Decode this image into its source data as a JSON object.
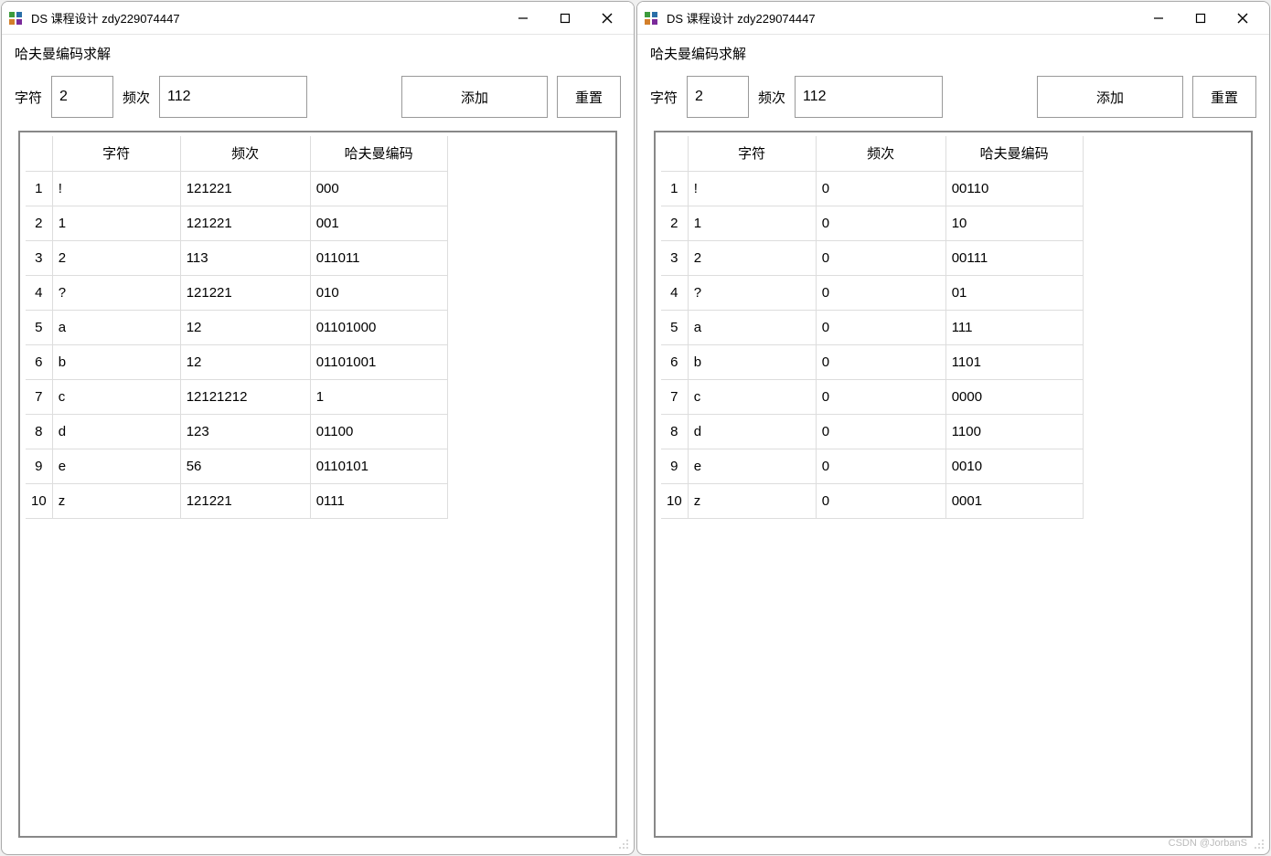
{
  "watermark": "CSDN @JorbanS",
  "windows": [
    {
      "title": "DS 课程设计 zdy229074447",
      "subtitle": "哈夫曼编码求解",
      "form": {
        "char_label": "字符",
        "char_value": "2",
        "freq_label": "频次",
        "freq_value": "112",
        "add_label": "添加",
        "reset_label": "重置"
      },
      "table": {
        "headers": {
          "char": "字符",
          "freq": "频次",
          "code": "哈夫曼编码"
        },
        "rows": [
          {
            "idx": "1",
            "char": "!",
            "freq": "121221",
            "code": "000"
          },
          {
            "idx": "2",
            "char": "1",
            "freq": "121221",
            "code": "001"
          },
          {
            "idx": "3",
            "char": "2",
            "freq": "113",
            "code": "011011"
          },
          {
            "idx": "4",
            "char": "?",
            "freq": "121221",
            "code": "010"
          },
          {
            "idx": "5",
            "char": "a",
            "freq": "12",
            "code": "01101000"
          },
          {
            "idx": "6",
            "char": "b",
            "freq": "12",
            "code": "01101001"
          },
          {
            "idx": "7",
            "char": "c",
            "freq": "12121212",
            "code": "1"
          },
          {
            "idx": "8",
            "char": "d",
            "freq": "123",
            "code": "01100"
          },
          {
            "idx": "9",
            "char": "e",
            "freq": "56",
            "code": "0110101"
          },
          {
            "idx": "10",
            "char": "z",
            "freq": "121221",
            "code": "0111"
          }
        ]
      }
    },
    {
      "title": "DS 课程设计 zdy229074447",
      "subtitle": "哈夫曼编码求解",
      "form": {
        "char_label": "字符",
        "char_value": "2",
        "freq_label": "频次",
        "freq_value": "112",
        "add_label": "添加",
        "reset_label": "重置"
      },
      "table": {
        "headers": {
          "char": "字符",
          "freq": "频次",
          "code": "哈夫曼编码"
        },
        "rows": [
          {
            "idx": "1",
            "char": "!",
            "freq": "0",
            "code": "00110"
          },
          {
            "idx": "2",
            "char": "1",
            "freq": "0",
            "code": "10"
          },
          {
            "idx": "3",
            "char": "2",
            "freq": "0",
            "code": "00111"
          },
          {
            "idx": "4",
            "char": "?",
            "freq": "0",
            "code": "01"
          },
          {
            "idx": "5",
            "char": "a",
            "freq": "0",
            "code": "111"
          },
          {
            "idx": "6",
            "char": "b",
            "freq": "0",
            "code": "1101"
          },
          {
            "idx": "7",
            "char": "c",
            "freq": "0",
            "code": "0000"
          },
          {
            "idx": "8",
            "char": "d",
            "freq": "0",
            "code": "1100"
          },
          {
            "idx": "9",
            "char": "e",
            "freq": "0",
            "code": "0010"
          },
          {
            "idx": "10",
            "char": "z",
            "freq": "0",
            "code": "0001"
          }
        ]
      }
    }
  ]
}
